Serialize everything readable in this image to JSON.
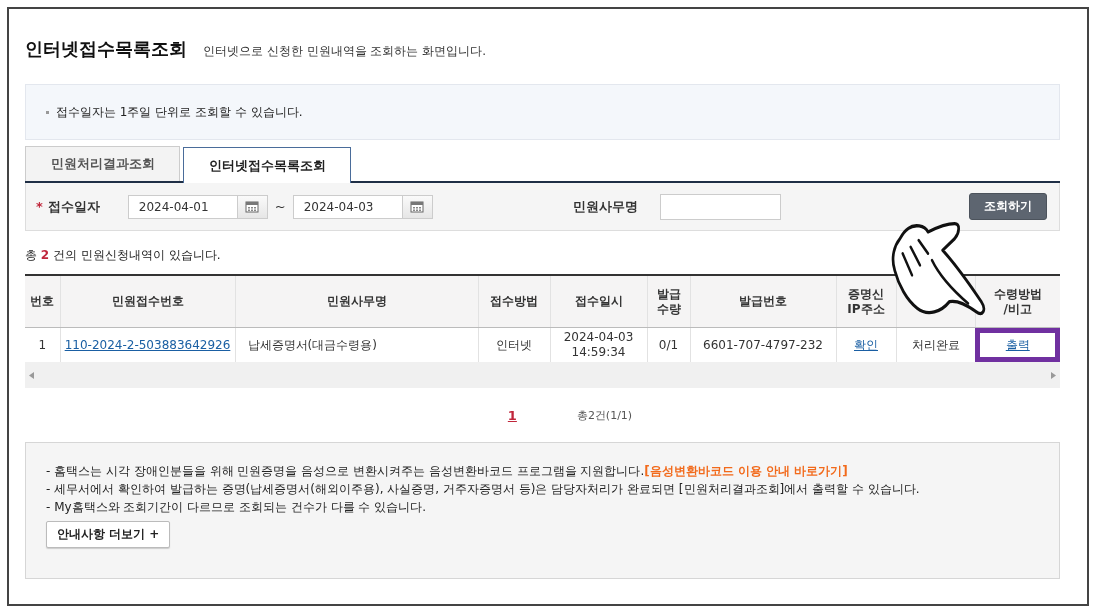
{
  "page_title": "인터넷접수목록조회",
  "page_description": "인터넷으로 신청한 민원내역을 조회하는 화면입니다.",
  "info_notes": [
    "접수일자는 1주일 단위로 조회할 수 있습니다."
  ],
  "tabs": [
    {
      "label": "민원처리결과조회",
      "selected": false
    },
    {
      "label": "인터넷접수목록조회",
      "selected": true
    }
  ],
  "search": {
    "required_mark": "*",
    "date_label": "접수일자",
    "start_date": "2024-04-01",
    "separator": "~",
    "end_date": "2024-04-03",
    "name_label": "민원사무명",
    "button": "조회하기"
  },
  "result_summary": "총 **2** 건의 민원신청내역이 있습니다.",
  "table": {
    "columns": [
      {
        "label": "번호"
      },
      {
        "label": "민원접수번호"
      },
      {
        "label": "민원사무명"
      },
      {
        "label": "접수방법"
      },
      {
        "label": "접수일시"
      },
      {
        "label": "발급\n수량"
      },
      {
        "label": "발급번호"
      },
      {
        "label": "증명신\nIP주소"
      },
      {},
      {
        "label": "수령방법\n/비고"
      }
    ],
    "rows": [
      {
        "cells": [
          {
            "text": "1",
            "kind": "text",
            "highlighted": false
          },
          {
            "text": "110-2024-2-503883642926",
            "kind": "link",
            "highlighted": false
          },
          {
            "text": "납세증명서(대금수령용)",
            "kind": "text",
            "highlighted": false
          },
          {
            "text": "인터넷",
            "kind": "text",
            "highlighted": false
          },
          {
            "text": "2024-04-03\n14:59:34",
            "kind": "text",
            "highlighted": false
          },
          {
            "text": "0/1",
            "kind": "text",
            "highlighted": false
          },
          {
            "text": "6601-707-4797-232",
            "kind": "text",
            "highlighted": false
          },
          {
            "text": "확인",
            "kind": "link",
            "highlighted": false
          },
          {
            "text": "처리완료",
            "kind": "text",
            "highlighted": false
          },
          {
            "text": "출력",
            "kind": "link",
            "highlighted": true
          }
        ]
      }
    ]
  },
  "pagination": {
    "pages": [
      {
        "label": "1",
        "selected": true
      }
    ],
    "total": "총2건(1/1)"
  },
  "guide": {
    "lines": [
      {
        "text": "- 홈택스는 시각 장애인분들을 위해 민원증명을 음성으로 변환시켜주는 음성변환바코드 프로그램을 지원합니다.",
        "link": "[음성변환바코드 이용 안내 바로가기]"
      },
      {
        "text": "- 세무서에서 확인하여 발급하는 증명(납세증명서(해외이주용), 사실증명, 거주자증명서 등)은 담당자처리가 완료되면 [민원처리결과조회]에서 출력할 수 있습니다."
      },
      {
        "text": "- My홈택스와 조회기간이 다르므로 조회되는 건수가 다를 수 있습니다."
      }
    ],
    "button": "안내사항 더보기 +"
  }
}
